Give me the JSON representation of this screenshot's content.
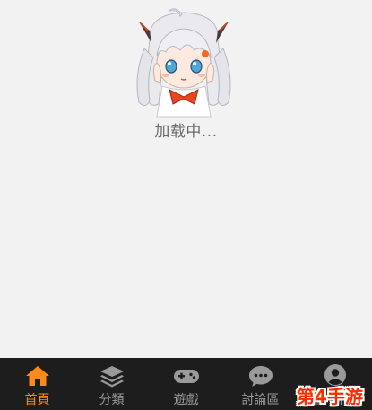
{
  "loading": {
    "text": "加载中..."
  },
  "tabs": [
    {
      "label": "首頁",
      "icon": "home-icon",
      "active": true
    },
    {
      "label": "分類",
      "icon": "layers-icon",
      "active": false
    },
    {
      "label": "遊戲",
      "icon": "gamepad-icon",
      "active": false
    },
    {
      "label": "討論區",
      "icon": "chat-bubble-icon",
      "active": false
    },
    {
      "label": "個人中心",
      "icon": "user-icon",
      "active": false
    }
  ],
  "watermark": {
    "text": "第4手游"
  },
  "colors": {
    "active": "#ff8a1a",
    "inactive": "#9a9a9a",
    "tabbar": "#1d1d1d",
    "background": "#f2f2f2"
  }
}
